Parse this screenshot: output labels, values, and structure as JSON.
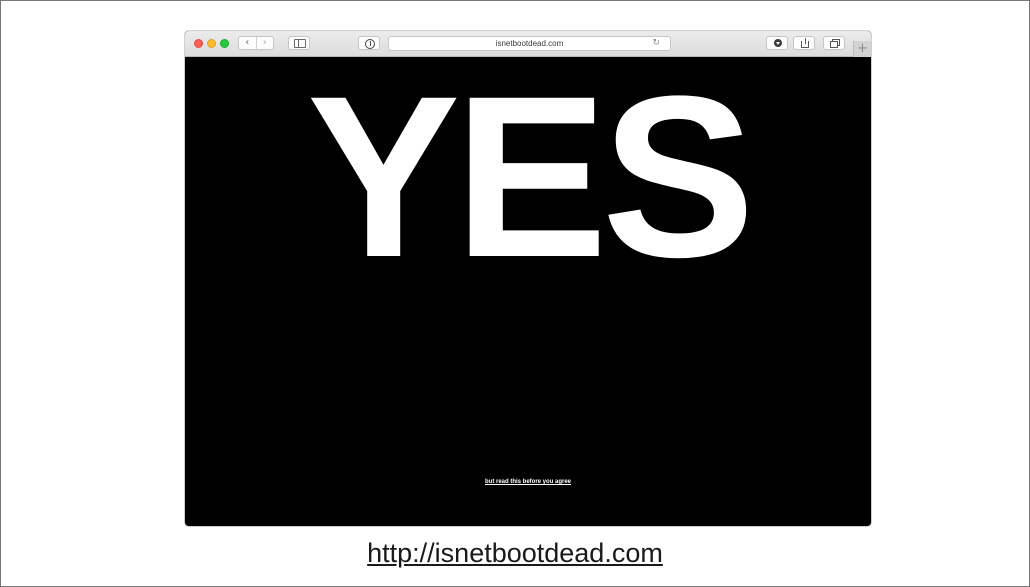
{
  "browser": {
    "address": "isnetbootdead.com",
    "reload_icon": "↻",
    "back_icon": "‹",
    "forward_icon": "›",
    "new_tab_icon": "+",
    "traffic_colors": {
      "close": "#fc5f57",
      "minimize": "#fdbc2e",
      "maximize": "#28c840"
    }
  },
  "page": {
    "headline": "YES",
    "link_text": "but read this before you agree",
    "background": "#000000",
    "text_color": "#ffffff"
  },
  "caption": {
    "url": "http://isnetbootdead.com"
  }
}
